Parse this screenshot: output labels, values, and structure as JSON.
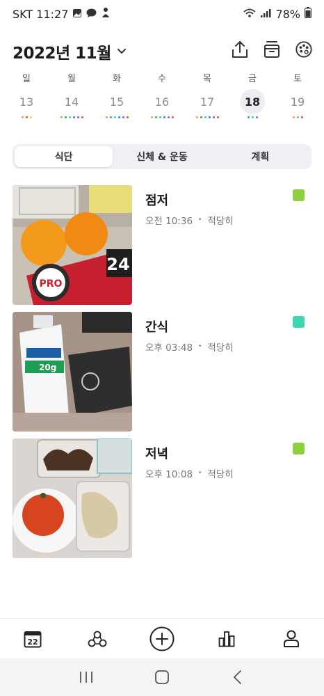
{
  "status": {
    "carrier_time": "SKT 11:27",
    "battery": "78%"
  },
  "header": {
    "month": "2022년 11월"
  },
  "week": [
    {
      "name": "일",
      "num": "13",
      "selected": false,
      "dots": [
        "#f2994a",
        "#e74c3c",
        "#f2c94c"
      ]
    },
    {
      "name": "월",
      "num": "14",
      "selected": false,
      "dots": [
        "#f2994a",
        "#27ae60",
        "#3cc8b4",
        "#2f80ed",
        "#9b51e0",
        "#e74c3c"
      ]
    },
    {
      "name": "화",
      "num": "15",
      "selected": false,
      "dots": [
        "#f2994a",
        "#27ae60",
        "#3cc8b4",
        "#2f80ed",
        "#9b51e0",
        "#e74c3c"
      ]
    },
    {
      "name": "수",
      "num": "16",
      "selected": false,
      "dots": [
        "#f2994a",
        "#27ae60",
        "#3cc8b4",
        "#2f80ed",
        "#9b51e0",
        "#e74c3c"
      ]
    },
    {
      "name": "목",
      "num": "17",
      "selected": false,
      "dots": [
        "#f2994a",
        "#27ae60",
        "#3cc8b4",
        "#2f80ed",
        "#9b51e0",
        "#e74c3c"
      ]
    },
    {
      "name": "금",
      "num": "18",
      "selected": true,
      "dots": [
        "#27ae60",
        "#3cc8b4",
        "#9b51e0"
      ]
    },
    {
      "name": "토",
      "num": "19",
      "selected": false,
      "dots": [
        "#f2994a",
        "#3cc8b4",
        "#e74c3c"
      ]
    }
  ],
  "tabs": [
    "식단",
    "신체 & 운동",
    "계획"
  ],
  "meals": [
    {
      "title": "점저",
      "time": "오전 10:36",
      "amount": "적당히",
      "tag_color": "#8ccf3f"
    },
    {
      "title": "간식",
      "time": "오후 03:48",
      "amount": "적당히",
      "tag_color": "#3dd6b0"
    },
    {
      "title": "저녁",
      "time": "오후 10:08",
      "amount": "적당히",
      "tag_color": "#8ccf3f"
    }
  ],
  "meta_separator": "•",
  "nav": {
    "calendar_day": "22"
  },
  "icons": {
    "share": "share-icon",
    "archive": "archive-icon",
    "palette": "palette-icon",
    "calendar": "calendar-icon",
    "community": "community-icon",
    "add": "add-icon",
    "stats": "bar-chart-icon",
    "profile": "profile-icon"
  }
}
